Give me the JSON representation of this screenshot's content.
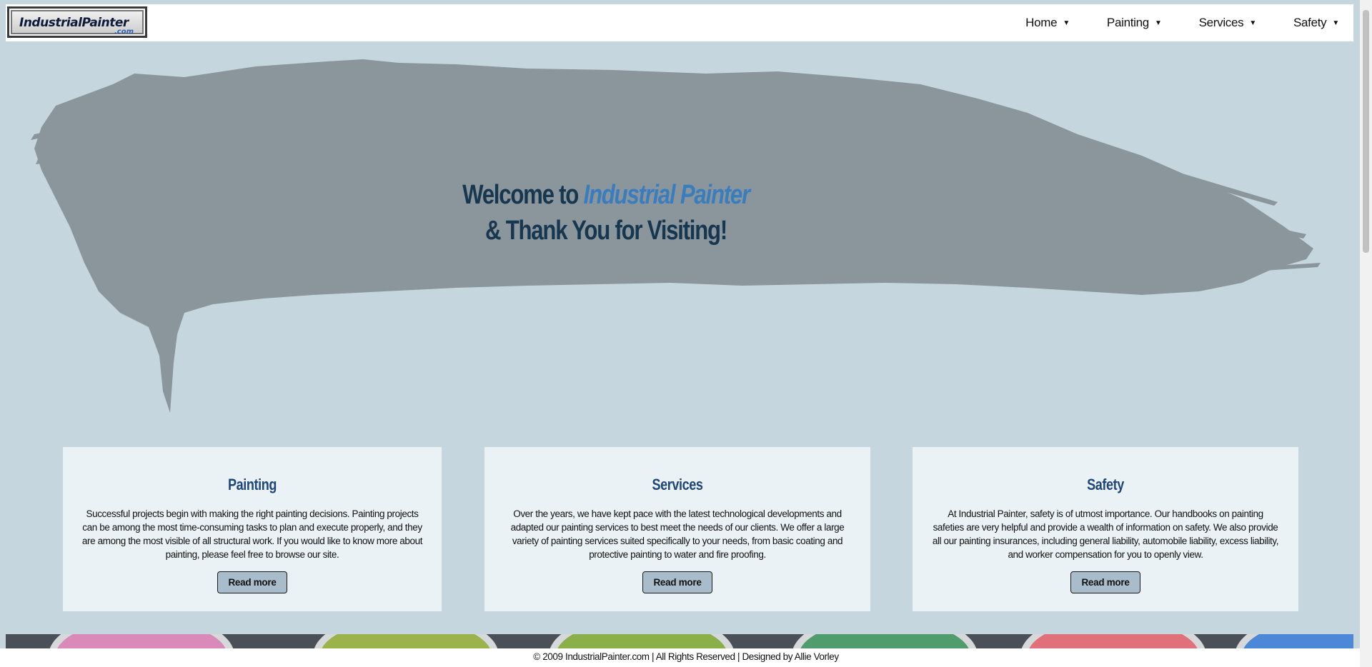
{
  "header": {
    "logo_text": "IndustrialPainter",
    "logo_sub": ".com",
    "nav": [
      {
        "label": "Home"
      },
      {
        "label": "Painting"
      },
      {
        "label": "Services"
      },
      {
        "label": "Safety"
      }
    ]
  },
  "hero": {
    "line1_prefix": "Welcome to ",
    "line1_brand": "Industrial Painter",
    "line2": "& Thank You for Visiting!"
  },
  "cards": [
    {
      "title": "Painting",
      "text": "Successful projects begin with making the right painting decisions. Painting projects can be among the most time-consuming tasks to plan and execute properly, and they are among the most visible of all structural work. If you would like to know more about painting, please feel free to browse our site.",
      "button": "Read more"
    },
    {
      "title": "Services",
      "text": "Over the years, we have kept pace with the latest technological developments and adapted our painting services to best meet the needs of our clients. We offer a large variety of painting services suited specifically to your needs, from basic coating and protective painting to water and fire proofing.",
      "button": "Read more"
    },
    {
      "title": "Safety",
      "text": "At Industrial Painter, safety is of utmost importance. Our handbooks on painting safeties are very helpful and provide a wealth of information on safety. We also provide all our painting insurances, including general liability, automobile liability, excess liability, and worker compensation for you to openly view.",
      "button": "Read more"
    }
  ],
  "footer": {
    "text": "© 2009 IndustrialPainter.com | All Rights Reserved | Designed by Allie Vorley"
  },
  "colors": {
    "background": "#c5d6df",
    "brush": "#8b959c",
    "heading": "#17364f",
    "brand": "#3a7dbf",
    "card_bg": "#eaf2f5",
    "button_bg": "#a9bccb"
  }
}
